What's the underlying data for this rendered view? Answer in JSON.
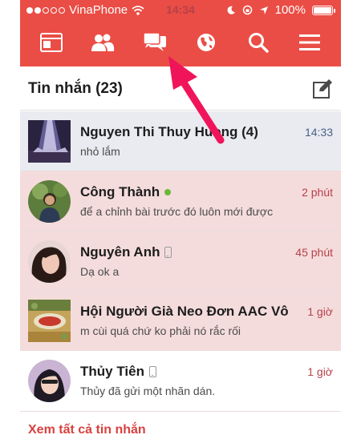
{
  "status_bar": {
    "carrier": "VinaPhone",
    "time": "14:34",
    "battery": "100%"
  },
  "tabs": [
    {
      "icon": "news-feed-icon"
    },
    {
      "icon": "friends-icon"
    },
    {
      "icon": "messages-icon"
    },
    {
      "icon": "globe-icon"
    },
    {
      "icon": "search-icon"
    },
    {
      "icon": "menu-icon"
    }
  ],
  "header": {
    "title": "Tin nhắn (23)",
    "compose_icon": "compose-icon"
  },
  "conversations": [
    {
      "name": "Nguyen Thi Thuy Huong (4)",
      "preview": "nhỏ lắm",
      "time": "14:33",
      "state": "selected"
    },
    {
      "name": "Công Thành",
      "preview": "để a chỉnh bài trước đó luôn mới được",
      "time": "2 phút",
      "state": "unread",
      "online": true
    },
    {
      "name": "Nguyên Anh",
      "preview": "Dạ ok a",
      "time": "45 phút",
      "state": "unread",
      "mobile": true
    },
    {
      "name": "Hội Người Già Neo Đơn AAC Vô",
      "preview": "m cùi quá chứ ko phải nó rắc rối",
      "time": "1 giờ",
      "state": "unread"
    },
    {
      "name": "Thủy Tiên",
      "preview": "Thủy đã gửi một nhãn dán.",
      "time": "1 giờ",
      "state": "read",
      "mobile": true
    }
  ],
  "footer": {
    "see_all": "Xem tất cả tin nhắn"
  },
  "colors": {
    "brand_red": "#ea4d45",
    "unread_bg": "#f5dcdc",
    "selected_bg": "#e9ebf1",
    "arrow": "#f0155a"
  }
}
